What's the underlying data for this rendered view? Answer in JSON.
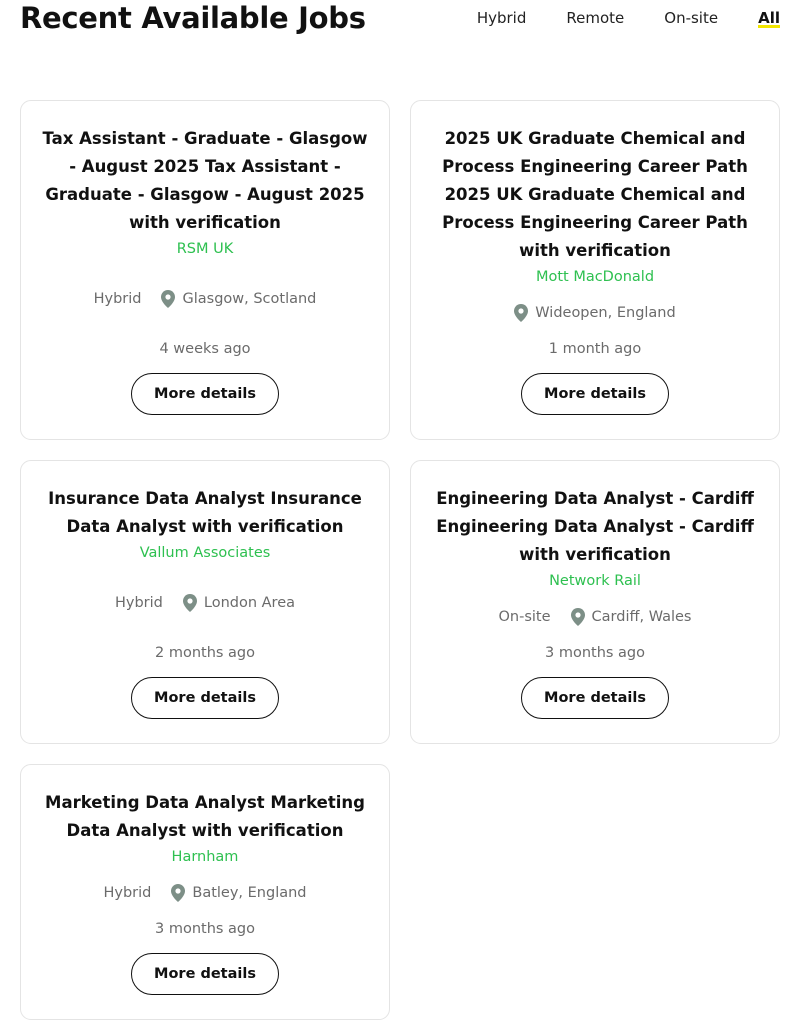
{
  "page": {
    "title": "Recent Available Jobs"
  },
  "filters": [
    {
      "label": "Hybrid",
      "active": false
    },
    {
      "label": "Remote",
      "active": false
    },
    {
      "label": "On-site",
      "active": false
    },
    {
      "label": "All",
      "active": true
    }
  ],
  "colors": {
    "company": "#2ec050",
    "active_underline": "#f2e600",
    "border": "#e4e4e4"
  },
  "jobs": [
    {
      "title": "Tax Assistant - Graduate - Glasgow - August 2025 Tax Assistant - Graduate - Glasgow - August 2025 with verification",
      "company": "RSM UK",
      "work_mode": "Hybrid",
      "location": "Glasgow, Scotland",
      "posted": "4 weeks ago",
      "button_label": "More details"
    },
    {
      "title": "2025 UK Graduate Chemical and Process Engineering Career Path 2025 UK Graduate Chemical and Process Engineering Career Path with verification",
      "company": "Mott MacDonald",
      "work_mode": "",
      "location": "Wideopen, England",
      "posted": "1 month ago",
      "button_label": "More details"
    },
    {
      "title": "Insurance Data Analyst Insurance Data Analyst with verification",
      "company": "Vallum Associates",
      "work_mode": "Hybrid",
      "location": "London Area",
      "posted": "2 months ago",
      "button_label": "More details"
    },
    {
      "title": "Engineering Data Analyst - Cardiff Engineering Data Analyst - Cardiff with verification",
      "company": "Network Rail",
      "work_mode": "On-site",
      "location": "Cardiff, Wales",
      "posted": "3 months ago",
      "button_label": "More details"
    },
    {
      "title": "Marketing Data Analyst Marketing Data Analyst with verification",
      "company": "Harnham",
      "work_mode": "Hybrid",
      "location": "Batley, England",
      "posted": "3 months ago",
      "button_label": "More details"
    }
  ]
}
